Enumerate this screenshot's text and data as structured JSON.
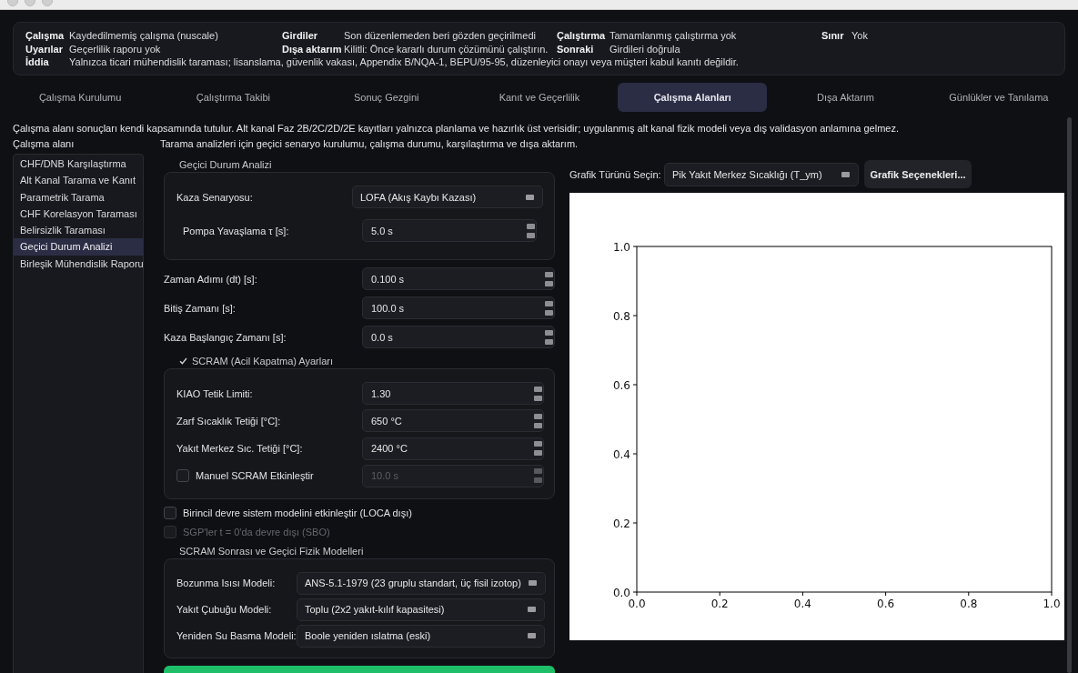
{
  "summary": {
    "rows": [
      [
        {
          "label": "Çalışma",
          "value": "Kaydedilmemiş çalışma (nuscale)"
        },
        {
          "label": "Girdiler",
          "value": "Son düzenlemeden beri gözden geçirilmedi"
        },
        {
          "label": "Çalıştırma",
          "value": "Tamamlanmış çalıştırma yok"
        },
        {
          "label": "Sınır",
          "value": "Yok"
        }
      ],
      [
        {
          "label": "Uyarılar",
          "value": "Geçerlilik raporu yok"
        },
        {
          "label": "Dışa aktarım",
          "value": "Kilitli: Önce kararlı durum çözümünü çalıştırın."
        },
        {
          "label": "Sonraki",
          "value": "Girdileri doğrula"
        }
      ],
      [
        {
          "label": "İddia",
          "value": "Yalnızca ticari mühendislik taraması; lisanslama, güvenlik vakası, Appendix B/NQA-1, BEPU/95-95, düzenleyici onayı veya müşteri kabul kanıtı değildir."
        }
      ]
    ]
  },
  "tabs": [
    {
      "label": "Çalışma Kurulumu",
      "selected": false
    },
    {
      "label": "Çalıştırma Takibi",
      "selected": false
    },
    {
      "label": "Sonuç Gezgini",
      "selected": false
    },
    {
      "label": "Kanıt ve Geçerlilik",
      "selected": false
    },
    {
      "label": "Çalışma Alanları",
      "selected": true
    },
    {
      "label": "Dışa Aktarım",
      "selected": false
    },
    {
      "label": "Günlükler ve Tanılama",
      "selected": false
    }
  ],
  "notice": "Çalışma alanı sonuçları kendi kapsamında tutulur. Alt kanal Faz 2B/2C/2D/2E kayıtları yalnızca planlama ve hazırlık üst verisidir; uygulanmış alt kanal fizik modeli veya dış validasyon anlamına gelmez.",
  "sidebar": {
    "title": "Çalışma alanı",
    "items": [
      {
        "label": "CHF/DNB Karşılaştırma",
        "selected": false
      },
      {
        "label": "Alt Kanal Tarama ve Kanıt",
        "selected": false
      },
      {
        "label": "Parametrik Tarama",
        "selected": false
      },
      {
        "label": "CHF Korelasyon Taraması",
        "selected": false
      },
      {
        "label": "Belirsizlik Taraması",
        "selected": false
      },
      {
        "label": "Geçici Durum Analizi",
        "selected": true
      },
      {
        "label": "Birleşik Mühendislik Raporu",
        "selected": false
      }
    ]
  },
  "description": "Tarama analizleri için geçici senaryo kurulumu, çalışma durumu, karşılaştırma ve dışa aktarım.",
  "transient": {
    "title": "Geçici Durum Analizi",
    "fields": [
      {
        "kind": "combo",
        "label": "Kaza Senaryosu:",
        "value": "LOFA (Akış Kaybı Kazası)"
      },
      {
        "kind": "spin",
        "label": "Pompa Yavaşlama τ [s]:",
        "value": "5.0 s"
      }
    ]
  },
  "time_fields": [
    {
      "kind": "spin",
      "label": "Zaman Adımı (dt) [s]:",
      "value": "0.100 s"
    },
    {
      "kind": "spin",
      "label": "Bitiş Zamanı [s]:",
      "value": "100.0 s"
    },
    {
      "kind": "spin",
      "label": "Kaza Başlangıç Zamanı [s]:",
      "value": "0.0 s"
    }
  ],
  "scram": {
    "title": "SCRAM (Acil Kapatma) Ayarları",
    "checked": true,
    "fields": [
      {
        "kind": "spin",
        "label": "KIAO Tetik Limiti:",
        "value": "1.30"
      },
      {
        "kind": "spin",
        "label": "Zarf Sıcaklık Tetiği [°C]:",
        "value": "650 °C"
      },
      {
        "kind": "spin",
        "label": "Yakıt Merkez Sıc. Tetiği [°C]:",
        "value": "2400 °C"
      },
      {
        "kind": "check_spin",
        "label": "Manuel SCRAM Etkinleştir",
        "checked": false,
        "value": "10.0 s",
        "disabled": true
      }
    ]
  },
  "options": [
    {
      "label": "Birincil devre sistem modelini etkinleştir (LOCA dışı)",
      "checked": false,
      "disabled": false
    },
    {
      "label": "SGP'ler t = 0'da devre dışı (SBO)",
      "checked": false,
      "disabled": true
    }
  ],
  "models": {
    "title": "SCRAM Sonrası ve Geçici Fizik Modelleri",
    "fields": [
      {
        "kind": "combo",
        "label": "Bozunma Isısı Modeli:",
        "value": "ANS-5.1-1979 (23 gruplu standart, üç fisil izotop)"
      },
      {
        "kind": "combo",
        "label": "Yakıt Çubuğu Modeli:",
        "value": "Toplu (2x2 yakıt-kılıf kapasitesi)"
      },
      {
        "kind": "combo",
        "label": "Yeniden Su Basma Modeli:",
        "value": "Boole yeniden ıslatma (eski)"
      }
    ]
  },
  "plot": {
    "type_label": "Grafik Türünü Seçin:",
    "type_value": "Pik Yakıt Merkez Sıcaklığı (T_ym)",
    "options_button": "Grafik Seçenekleri...",
    "chart_data": {
      "type": "line",
      "xlim": [
        0,
        1
      ],
      "ylim": [
        0,
        1
      ],
      "xticks": [
        {
          "value": 0,
          "label": "0.0"
        },
        {
          "value": 0.2,
          "label": "0.2"
        },
        {
          "value": 0.4,
          "label": "0.4"
        },
        {
          "value": 0.6,
          "label": "0.6"
        },
        {
          "value": 0.8,
          "label": "0.8"
        },
        {
          "value": 1,
          "label": "1.0"
        }
      ],
      "yticks": [
        {
          "value": 0,
          "label": "0.0"
        },
        {
          "value": 0.2,
          "label": "0.2"
        },
        {
          "value": 0.4,
          "label": "0.4"
        },
        {
          "value": 0.6,
          "label": "0.6"
        },
        {
          "value": 0.8,
          "label": "0.8"
        },
        {
          "value": 1,
          "label": "1.0"
        }
      ]
    }
  }
}
